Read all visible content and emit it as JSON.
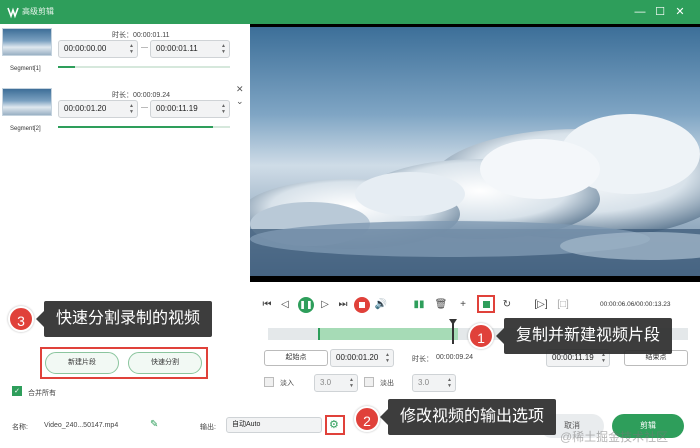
{
  "window": {
    "title": "高级剪辑",
    "controls": [
      "—",
      "☐",
      "✕"
    ]
  },
  "segments": [
    {
      "label": "Segment[1]",
      "duration_label": "时长：00:00:01.11",
      "start": "00:00:00.00",
      "end": "00:00:01.11",
      "progress": 0.1
    },
    {
      "label": "Segment[2]",
      "duration_label": "时长：00:00:09.24",
      "start": "00:00:01.20",
      "end": "00:00:11.19",
      "progress": 0.9
    }
  ],
  "player": {
    "time_readout": "00:00:06.06/00:00:13.23"
  },
  "timeline": {
    "start_button": "起始点",
    "start_time": "00:00:01.20",
    "duration_label": "时长：",
    "duration_value": "00:00:09.24",
    "end_time": "00:00:11.19",
    "end_button": "结束点",
    "fade_in_label": "淡入",
    "fade_in_value": "3.0",
    "fade_out_label": "淡出",
    "fade_out_value": "3.0"
  },
  "left_actions": {
    "new_segment": "新建片段",
    "quick_split": "快速分割",
    "merge_all": "合并所有"
  },
  "footer": {
    "name_label": "名称:",
    "file_name": "Video_240...50147.mp4",
    "output_label": "输出:",
    "output_value": "自动Auto",
    "cancel_label": "取消",
    "confirm_label": "剪辑"
  },
  "annotations": [
    {
      "number": "1",
      "text": "复制并新建视频片段"
    },
    {
      "number": "2",
      "text": "修改视频的输出选项"
    },
    {
      "number": "3",
      "text": "快速分割录制的视频"
    }
  ],
  "watermark": "@稀土掘金技术社区",
  "colors": {
    "accent": "#2e9e5b",
    "highlight": "#e0413a"
  }
}
